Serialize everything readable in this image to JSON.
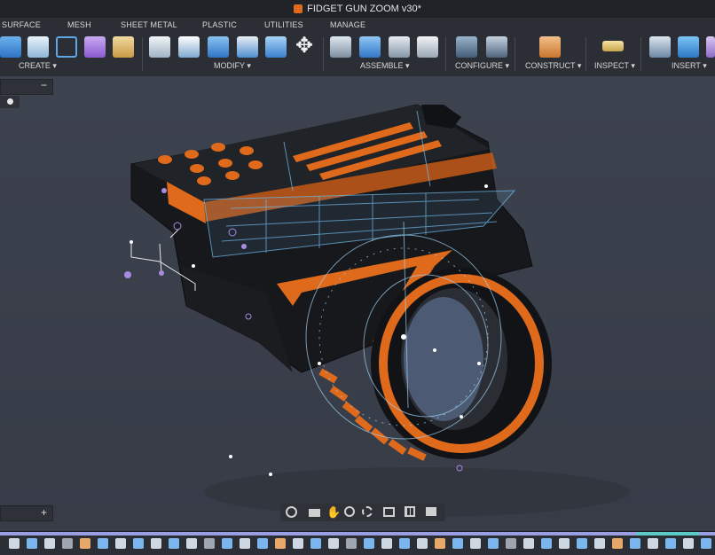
{
  "window": {
    "title": "FIDGET GUN ZOOM v30*"
  },
  "tabs": [
    "SURFACE",
    "MESH",
    "SHEET METAL",
    "PLASTIC",
    "UTILITIES",
    "MANAGE"
  ],
  "toolbar": {
    "groups": [
      "CREATE",
      "MODIFY",
      "ASSEMBLE",
      "CONFIGURE",
      "CONSTRUCT",
      "INSPECT",
      "INSERT"
    ],
    "dropdown_glyph": "▾"
  },
  "browser": {
    "collapse_glyph": "−"
  },
  "comments": {
    "add_glyph": "+"
  },
  "colors": {
    "accent_orange": "#e06a1c",
    "body_dark": "#15171a",
    "sketch_blue": "#6fb6e6",
    "point_purple": "#a98be0",
    "timeline_track": "#9a9fe3"
  }
}
